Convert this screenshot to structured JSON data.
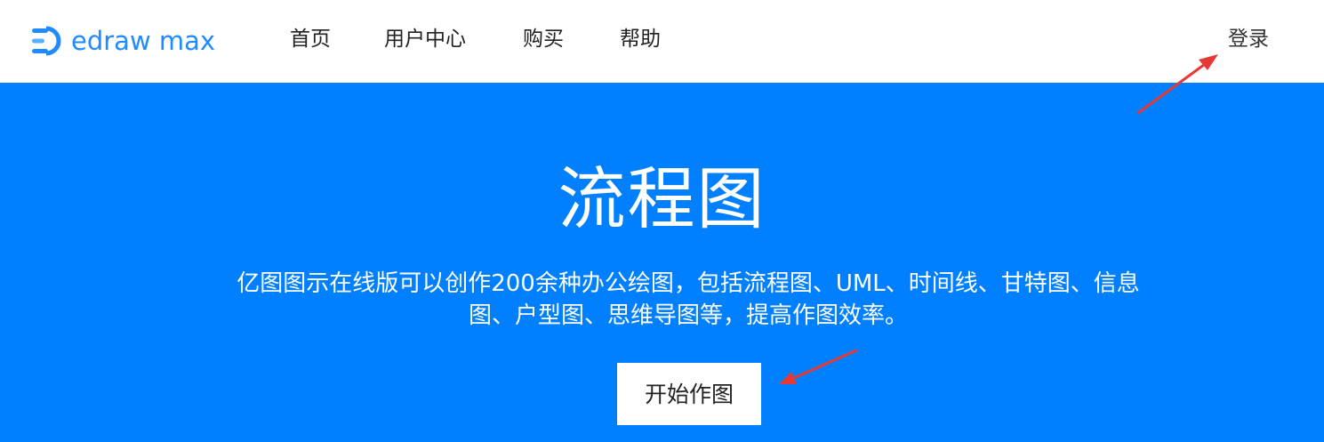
{
  "brand": {
    "name": "edraw max",
    "color": "#1f8bff"
  },
  "nav": {
    "items": [
      {
        "label": "首页"
      },
      {
        "label": "用户中心"
      },
      {
        "label": "购买"
      },
      {
        "label": "帮助"
      }
    ],
    "login_label": "登录"
  },
  "hero": {
    "title": "流程图",
    "description": "亿图图示在线版可以创作200余种办公绘图，包括流程图、UML、时间线、甘特图、信息图、户型图、思维导图等，提高作图效率。",
    "cta_label": "开始作图",
    "background": "#0080ff"
  },
  "annotations": {
    "arrow_color": "#e53935",
    "arrows": [
      "login-pointer-arrow",
      "start-button-pointer-arrow"
    ]
  }
}
